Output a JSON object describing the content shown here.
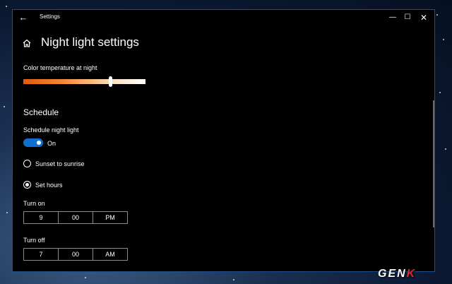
{
  "window": {
    "title": "Settings",
    "back_icon": "back-arrow-icon",
    "minimize_icon": "minimize-icon",
    "maximize_icon": "maximize-icon",
    "close_icon": "close-icon"
  },
  "page": {
    "title": "Night light settings",
    "home_icon": "home-icon"
  },
  "color_temperature": {
    "label": "Color temperature at night",
    "value_fraction": 0.71
  },
  "schedule": {
    "heading": "Schedule",
    "schedule_label": "Schedule night light",
    "toggle_state": "On",
    "options": [
      {
        "label": "Sunset to sunrise",
        "selected": false
      },
      {
        "label": "Set hours",
        "selected": true
      }
    ],
    "turn_on": {
      "label": "Turn on",
      "hour": "9",
      "minute": "00",
      "period": "PM"
    },
    "turn_off": {
      "label": "Turn off",
      "hour": "7",
      "minute": "00",
      "period": "AM"
    }
  },
  "watermark": {
    "text_main": "GEN",
    "text_accent": "K"
  },
  "colors": {
    "accent": "#0f6fd1",
    "window_bg": "#000000",
    "border": "#1f4f8c"
  }
}
